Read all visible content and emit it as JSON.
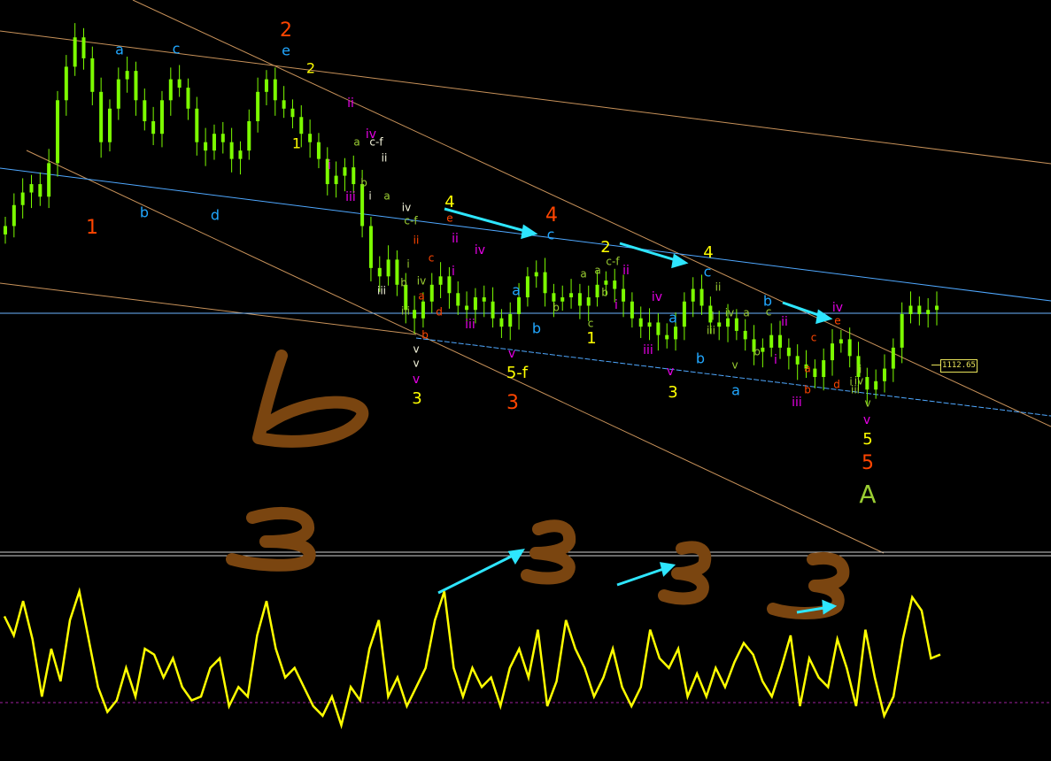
{
  "colors": {
    "background": "#000000",
    "candle": "#7CFC00",
    "oscillator": "#ffff00",
    "trend_orange": "#c8925a",
    "trend_blue": "#4fa8ff",
    "arrow": "#2ee6ff",
    "hand_drawn": "#7a4510",
    "label_yellow": "#ffff00",
    "label_red": "#ff4500",
    "label_blue": "#21a7ff",
    "label_magenta": "#e600e6",
    "label_olive": "#9acd32",
    "label_white": "#f5f5dc"
  },
  "price_tag": "1112.65",
  "handwritten": [
    "b",
    "3",
    "3",
    "3",
    "3"
  ],
  "wave_labels": [
    {
      "text": "1",
      "color": "red"
    },
    {
      "text": "a",
      "color": "blue"
    },
    {
      "text": "c",
      "color": "blue"
    },
    {
      "text": "2",
      "color": "red"
    },
    {
      "text": "e",
      "color": "blue"
    },
    {
      "text": "2",
      "color": "yellow"
    },
    {
      "text": "b",
      "color": "blue"
    },
    {
      "text": "d",
      "color": "blue"
    },
    {
      "text": "1",
      "color": "yellow"
    },
    {
      "text": "i",
      "color": "magenta"
    },
    {
      "text": "ii",
      "color": "magenta"
    },
    {
      "text": "iii",
      "color": "magenta"
    },
    {
      "text": "iv",
      "color": "magenta"
    },
    {
      "text": "a",
      "color": "olive"
    },
    {
      "text": "c-f",
      "color": "white"
    },
    {
      "text": "ii",
      "color": "white"
    },
    {
      "text": "b",
      "color": "olive"
    },
    {
      "text": "i",
      "color": "white"
    },
    {
      "text": "a",
      "color": "olive"
    },
    {
      "text": "iv",
      "color": "white"
    },
    {
      "text": "c-f",
      "color": "olive"
    },
    {
      "text": "ii",
      "color": "red"
    },
    {
      "text": "i",
      "color": "olive"
    },
    {
      "text": "b",
      "color": "olive"
    },
    {
      "text": "iii",
      "color": "white"
    },
    {
      "text": "iv",
      "color": "olive"
    },
    {
      "text": "a",
      "color": "red"
    },
    {
      "text": "iii",
      "color": "olive"
    },
    {
      "text": "b",
      "color": "red"
    },
    {
      "text": "v",
      "color": "white"
    },
    {
      "text": "v",
      "color": "white"
    },
    {
      "text": "v",
      "color": "magenta"
    },
    {
      "text": "3",
      "color": "yellow"
    },
    {
      "text": "c",
      "color": "red"
    },
    {
      "text": "d",
      "color": "red"
    },
    {
      "text": "4",
      "color": "yellow"
    },
    {
      "text": "e",
      "color": "red"
    },
    {
      "text": "ii",
      "color": "magenta"
    },
    {
      "text": "i",
      "color": "magenta"
    },
    {
      "text": "iv",
      "color": "magenta"
    },
    {
      "text": "iii",
      "color": "magenta"
    },
    {
      "text": "a",
      "color": "blue"
    },
    {
      "text": "4",
      "color": "red"
    },
    {
      "text": "c",
      "color": "blue"
    },
    {
      "text": "b",
      "color": "blue"
    },
    {
      "text": "v",
      "color": "magenta"
    },
    {
      "text": "5-f",
      "color": "yellow"
    },
    {
      "text": "3",
      "color": "red"
    },
    {
      "text": "a",
      "color": "olive"
    },
    {
      "text": "b",
      "color": "olive"
    },
    {
      "text": "2",
      "color": "yellow"
    },
    {
      "text": "a",
      "color": "olive"
    },
    {
      "text": "c-f",
      "color": "olive"
    },
    {
      "text": "b",
      "color": "olive"
    },
    {
      "text": "ii",
      "color": "magenta"
    },
    {
      "text": "c",
      "color": "olive"
    },
    {
      "text": "i",
      "color": "magenta"
    },
    {
      "text": "1",
      "color": "yellow"
    },
    {
      "text": "iv",
      "color": "magenta"
    },
    {
      "text": "a",
      "color": "blue"
    },
    {
      "text": "iii",
      "color": "magenta"
    },
    {
      "text": "v",
      "color": "magenta"
    },
    {
      "text": "3",
      "color": "yellow"
    },
    {
      "text": "4",
      "color": "yellow"
    },
    {
      "text": "c",
      "color": "blue"
    },
    {
      "text": "ii",
      "color": "olive"
    },
    {
      "text": "i",
      "color": "olive"
    },
    {
      "text": "iii",
      "color": "olive"
    },
    {
      "text": "b",
      "color": "blue"
    },
    {
      "text": "iv",
      "color": "olive"
    },
    {
      "text": "a",
      "color": "olive"
    },
    {
      "text": "v",
      "color": "olive"
    },
    {
      "text": "b",
      "color": "blue"
    },
    {
      "text": "c",
      "color": "olive"
    },
    {
      "text": "b",
      "color": "olive"
    },
    {
      "text": "i",
      "color": "magenta"
    },
    {
      "text": "ii",
      "color": "magenta"
    },
    {
      "text": "a",
      "color": "blue"
    },
    {
      "text": "iv",
      "color": "magenta"
    },
    {
      "text": "e",
      "color": "red"
    },
    {
      "text": "c",
      "color": "red"
    },
    {
      "text": "a",
      "color": "red"
    },
    {
      "text": "b",
      "color": "red"
    },
    {
      "text": "iii",
      "color": "magenta"
    },
    {
      "text": "d",
      "color": "red"
    },
    {
      "text": "i",
      "color": "olive"
    },
    {
      "text": "ii",
      "color": "olive"
    },
    {
      "text": "iv",
      "color": "olive"
    },
    {
      "text": "iii",
      "color": "olive"
    },
    {
      "text": "v",
      "color": "olive"
    },
    {
      "text": "v",
      "color": "magenta"
    },
    {
      "text": "5",
      "color": "yellow"
    },
    {
      "text": "5",
      "color": "red"
    },
    {
      "text": "A",
      "color": "olive"
    }
  ],
  "chart_data": {
    "type": "line",
    "panels": [
      {
        "name": "",
        "style": "candlestick",
        "close": [
          1130,
          1135,
          1138,
          1140,
          1137,
          1145,
          1160,
          1168,
          1175,
          1170,
          1162,
          1150,
          1158,
          1165,
          1167,
          1160,
          1155,
          1152,
          1160,
          1165,
          1163,
          1158,
          1150,
          1148,
          1152,
          1150,
          1146,
          1148,
          1155,
          1162,
          1165,
          1160,
          1158,
          1156,
          1152,
          1150,
          1146,
          1140,
          1142,
          1144,
          1140,
          1130,
          1120,
          1118,
          1122,
          1116,
          1110,
          1108,
          1112,
          1116,
          1118,
          1114,
          1111,
          1110,
          1113,
          1112,
          1108,
          1106,
          1109,
          1113,
          1118,
          1119,
          1114,
          1112,
          1113,
          1114,
          1111,
          1113,
          1116,
          1117,
          1115,
          1112,
          1108,
          1106,
          1107,
          1104,
          1103,
          1106,
          1112,
          1115,
          1111,
          1107,
          1106,
          1108,
          1105,
          1103,
          1100,
          1101,
          1104,
          1101,
          1099,
          1097,
          1096,
          1094,
          1098,
          1102,
          1103,
          1099,
          1094,
          1091,
          1093,
          1096,
          1101,
          1109,
          1111,
          1109,
          1110,
          1111
        ]
      },
      {
        "name": "",
        "style": "line",
        "values": [
          72,
          62,
          80,
          60,
          30,
          55,
          38,
          70,
          85,
          60,
          35,
          22,
          28,
          45,
          30,
          55,
          52,
          40,
          50,
          35,
          28,
          30,
          45,
          50,
          25,
          35,
          30,
          62,
          80,
          55,
          40,
          45,
          35,
          25,
          20,
          30,
          15,
          35,
          28,
          55,
          70,
          30,
          40,
          25,
          35,
          45,
          70,
          85,
          45,
          30,
          45,
          35,
          40,
          25,
          45,
          55,
          40,
          65,
          25,
          38,
          70,
          55,
          45,
          30,
          40,
          55,
          35,
          25,
          35,
          65,
          50,
          45,
          55,
          30,
          42,
          30,
          45,
          35,
          48,
          58,
          52,
          38,
          30,
          45,
          62,
          25,
          50,
          40,
          35,
          60,
          45,
          25,
          65,
          40,
          20,
          30,
          60,
          82,
          75,
          50,
          52
        ]
      }
    ]
  }
}
